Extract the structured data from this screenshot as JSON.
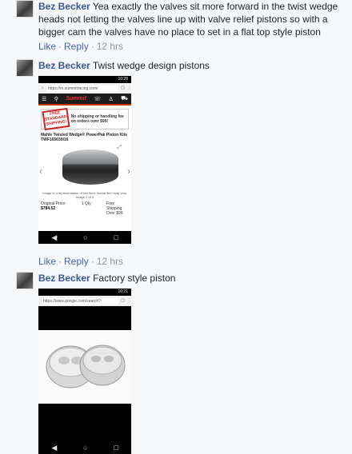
{
  "comments": [
    {
      "author": "Bez Becker",
      "text": "Yea exactly the valves sit more forward in the twist wedge heads not letting the valves line up with valve relief pistons so with a bigger cam the valves have no place to set in a flat top style piston",
      "like": "Like",
      "reply": "Reply",
      "time": "12 hrs"
    },
    {
      "author": "Bez Becker",
      "text": "Twist wedge design pistons",
      "like": "Like",
      "reply": "Reply",
      "time": "12 hrs",
      "screenshot": {
        "status_time": "10:28",
        "url": "https://m.summitracing.com/",
        "logo": "Summit",
        "stamp": "FREE STANDARD SHIPPING!",
        "banner": "No shipping or handling fee on orders over $99!",
        "product_title": "Mahle Twisted Wedge® PowerPak Piston Kits TWF165030I16",
        "caption": "Image is a representation of this item. Actual item may vary.",
        "image_count": "Image 2 of 2",
        "original_price_label": "Original Price:",
        "price": "$784.52",
        "qty_value": "1",
        "qty_label": "Qty",
        "shipping": "Free Shipping Over $99"
      }
    },
    {
      "author": "Bez Becker",
      "text": "Factory style piston",
      "screenshot": {
        "status_time": "10:21",
        "url": "https://www.google.com/search?"
      }
    }
  ],
  "nav": {
    "back": "◀",
    "home": "○",
    "recents": "□"
  }
}
